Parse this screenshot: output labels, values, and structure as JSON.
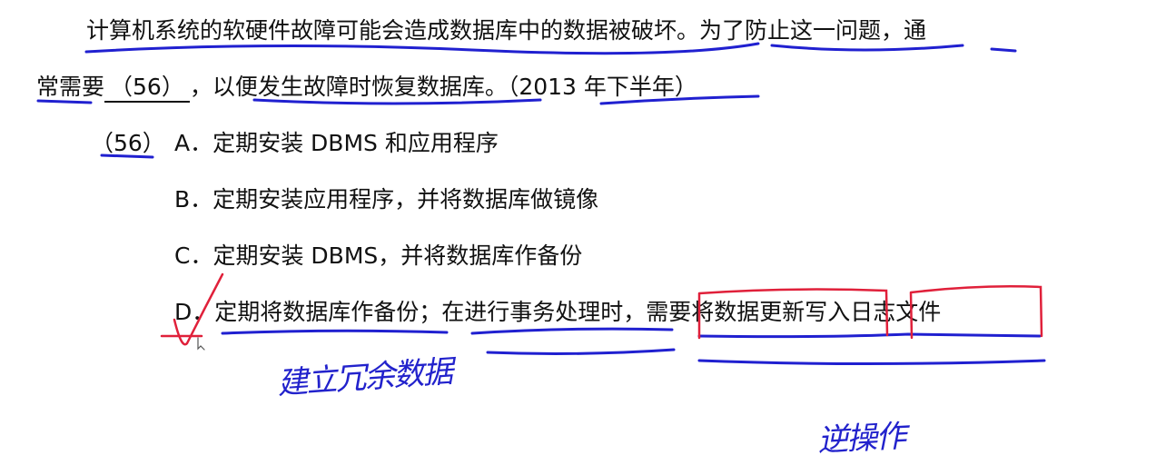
{
  "question": {
    "line1": "计算机系统的软硬件故障可能会造成数据库中的数据被破坏。为了防止这一问题，通",
    "line2_prefix": "常需要",
    "blank": "（56）",
    "line2_suffix": "，以便发生故障时恢复数据库。（2013 年下半年）"
  },
  "options": {
    "number": "（56）",
    "items": [
      {
        "letter": "A．",
        "text": "定期安装 DBMS 和应用程序"
      },
      {
        "letter": "B．",
        "text": "定期安装应用程序，并将数据库做镜像"
      },
      {
        "letter": "C．",
        "text": "定期安装 DBMS，并将数据库作备份"
      },
      {
        "letter": "D．",
        "text": "定期将数据库作备份；在进行事务处理时，需要将数据更新写入日志文件"
      }
    ]
  },
  "annotations": {
    "note_redundant": "建立冗余数据",
    "note_reverse": "逆操作",
    "ink_blue": "#2020d0",
    "ink_red": "#e0203a"
  }
}
